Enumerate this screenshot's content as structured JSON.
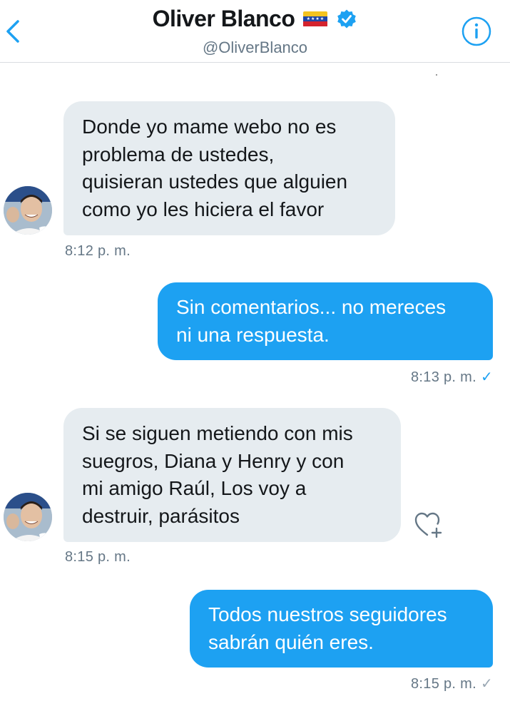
{
  "header": {
    "name": "Oliver Blanco",
    "handle": "@OliverBlanco",
    "icons": [
      "chevron-left-icon",
      "venezuela-flag-icon",
      "verified-badge-icon",
      "info-icon"
    ]
  },
  "colors": {
    "accent": "#1da1f2",
    "received_bubble": "#e6ecf0",
    "secondary_text": "#657786"
  },
  "messages": [
    {
      "direction": "received",
      "text": "Donde yo mame webo no es\nproblema de ustedes,\nquisieran ustedes que alguien\ncomo yo les hiciera el favor",
      "time": "8:12 p. m."
    },
    {
      "direction": "sent",
      "text": "Sin comentarios... no mereces\nni una respuesta.",
      "time": "8:13 p. m.",
      "status": "✓"
    },
    {
      "direction": "received",
      "text": "Si se siguen metiendo con mis\nsuegros, Diana y Henry y con\nmi amigo Raúl, Los voy a\ndestruir, parásitos",
      "time": "8:15 p. m.",
      "action_icon": "heart-plus-icon"
    },
    {
      "direction": "sent",
      "text": "Todos nuestros seguidores\nsabrán quién eres.",
      "time": "8:15 p. m.",
      "status": "✓"
    }
  ]
}
